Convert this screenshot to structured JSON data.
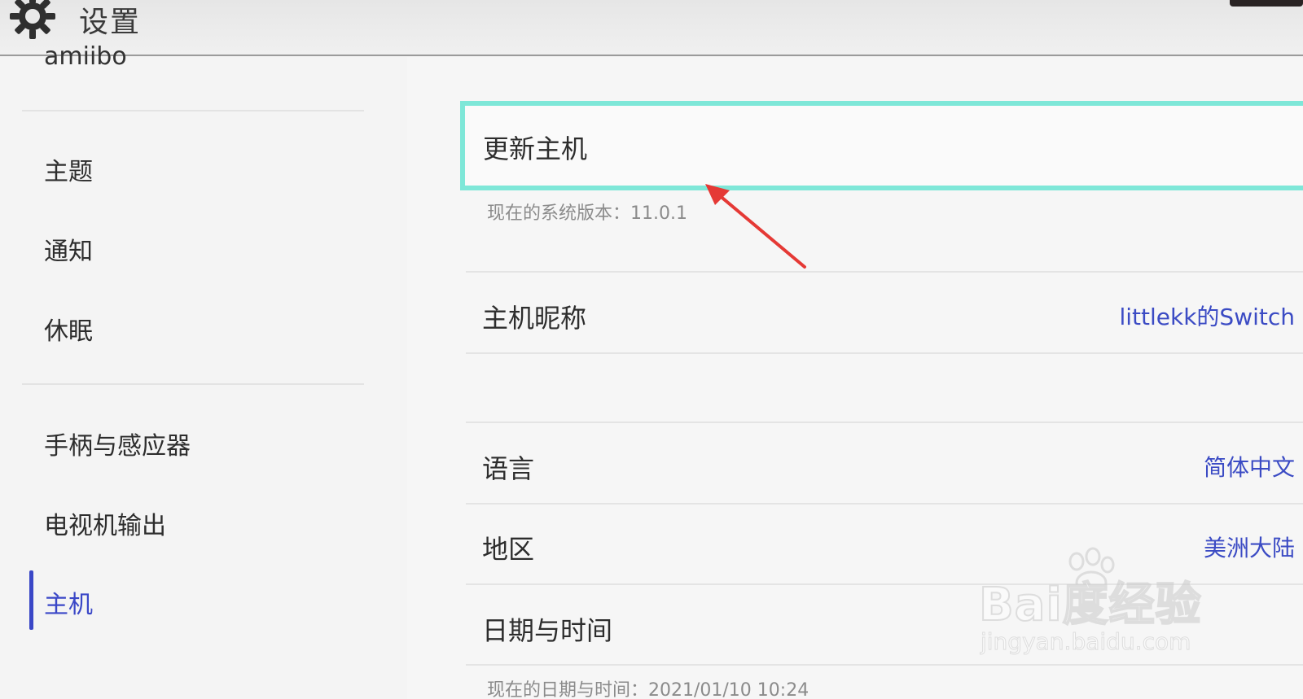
{
  "header": {
    "title": "设置",
    "icon": "gear-icon"
  },
  "sidebar": {
    "cut_item": "amiibo",
    "items": [
      {
        "label": "主题"
      },
      {
        "label": "通知"
      },
      {
        "label": "休眠"
      },
      {
        "label": "手柄与感应器"
      },
      {
        "label": "电视机输出"
      },
      {
        "label": "主机",
        "active": true
      }
    ]
  },
  "main": {
    "update": {
      "label": "更新主机",
      "subtext": "现在的系统版本：11.0.1"
    },
    "nickname": {
      "label": "主机昵称",
      "value": "littlekk的Switch"
    },
    "language": {
      "label": "语言",
      "value": "简体中文"
    },
    "region": {
      "label": "地区",
      "value": "美洲大陆"
    },
    "datetime": {
      "label": "日期与时间",
      "subtext": "现在的日期与时间：2021/01/10 10:24"
    }
  },
  "watermark": {
    "brand": "Bai度经验",
    "url": "jingyan.baidu.com"
  },
  "colors": {
    "accent": "#3a47c7",
    "focus_border": "#7ee7d8",
    "value_text": "#3b4bc4",
    "arrow": "#e53935"
  }
}
